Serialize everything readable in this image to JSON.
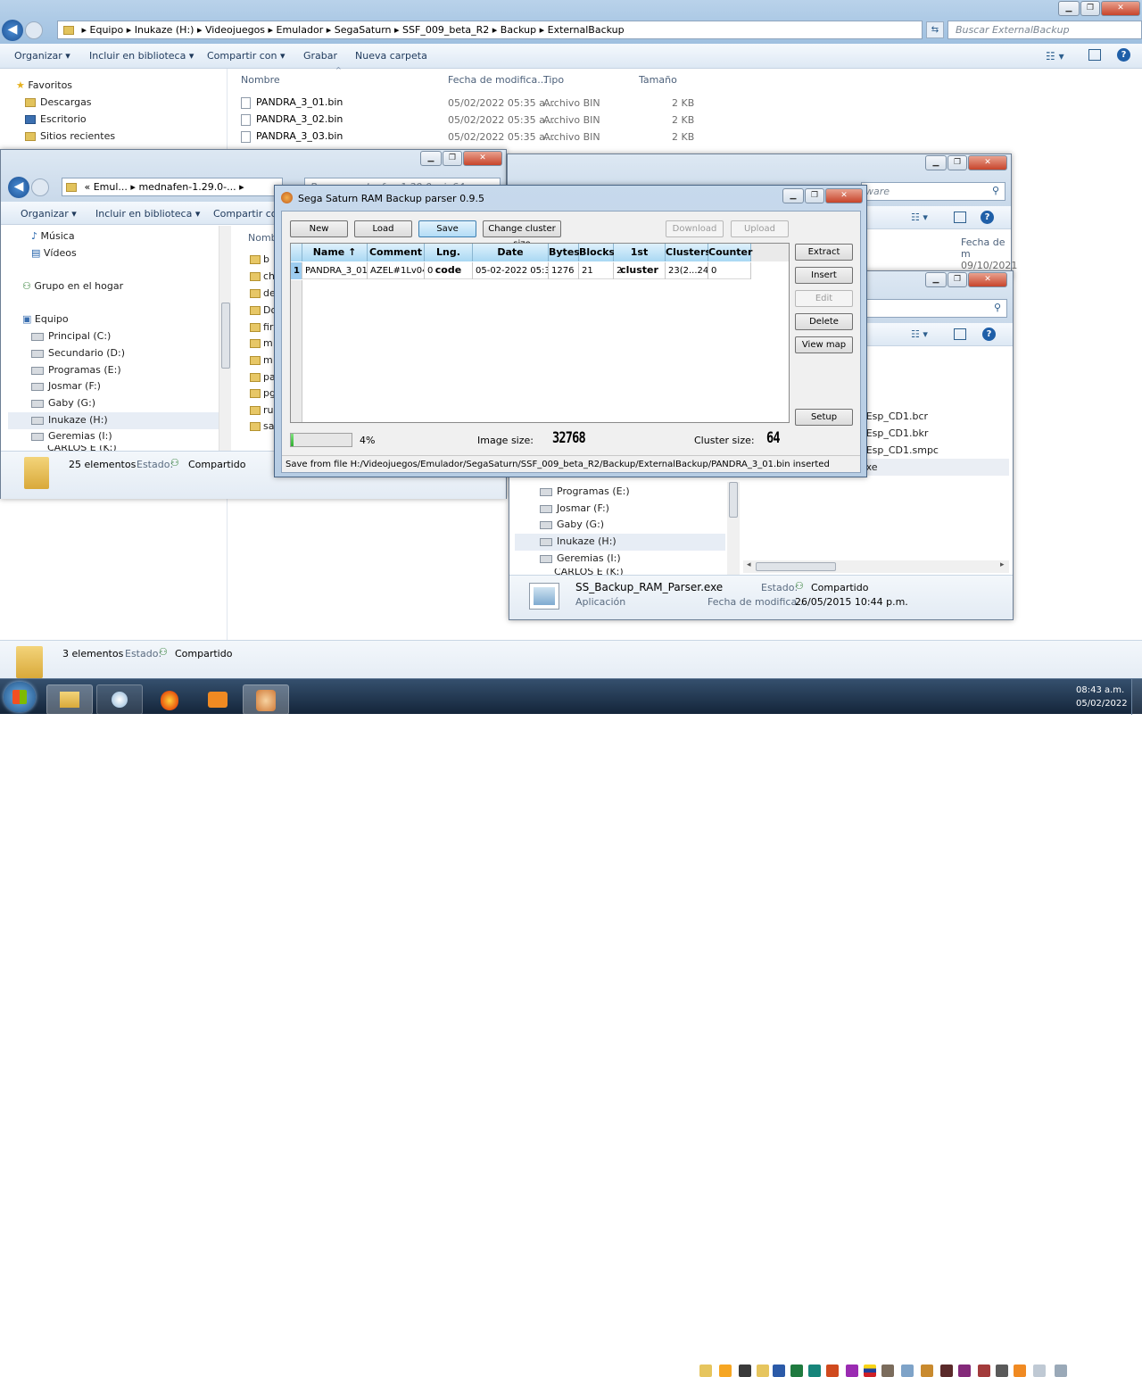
{
  "main_window": {
    "breadcrumb": [
      "Equipo",
      "Inukaze (H:)",
      "Videojuegos",
      "Emulador",
      "SegaSaturn",
      "SSF_009_beta_R2",
      "Backup",
      "ExternalBackup"
    ],
    "search_placeholder": "Buscar ExternalBackup",
    "toolbar": [
      "Organizar",
      "Incluir en biblioteca",
      "Compartir con",
      "Grabar",
      "Nueva carpeta"
    ],
    "nav": {
      "favorites": "Favoritos",
      "fav_items": [
        "Descargas",
        "Escritorio",
        "Sitios recientes"
      ]
    },
    "columns": [
      "Nombre",
      "Fecha de modifica...",
      "Tipo",
      "Tamaño"
    ],
    "files": [
      {
        "name": "PANDRA_3_01.bin",
        "date": "05/02/2022 05:35 a...",
        "type": "Archivo BIN",
        "size": "2 KB"
      },
      {
        "name": "PANDRA_3_02.bin",
        "date": "05/02/2022 05:35 a...",
        "type": "Archivo BIN",
        "size": "2 KB"
      },
      {
        "name": "PANDRA_3_03.bin",
        "date": "05/02/2022 05:35 a...",
        "type": "Archivo BIN",
        "size": "2 KB"
      }
    ],
    "status_count": "3 elementos",
    "status_label": "Estado:",
    "status_value": "Compartido"
  },
  "left_window": {
    "breadcrumb": [
      "«",
      "Emul...",
      "mednafen-1.29.0-..."
    ],
    "search_placeholder": "Buscar mednafen-1.29.0-win64",
    "toolbar": [
      "Organizar",
      "Incluir en biblioteca",
      "Compartir con"
    ],
    "nav": [
      "Música",
      "Vídeos",
      "Grupo en el hogar",
      "Equipo",
      "Principal (C:)",
      "Secundario (D:)",
      "Programas (E:)",
      "Josmar (F:)",
      "Gaby (G:)",
      "Inukaze (H:)",
      "Geremias (I:)",
      "CARLOS E (K:)"
    ],
    "column": "Nombr",
    "folders": [
      "b",
      "ch",
      "de",
      "Do",
      "fir",
      "m",
      "m",
      "pa",
      "pg",
      "ru",
      "sa"
    ],
    "status_count": "25 elementos",
    "status_label": "Estado:",
    "status_value": "Compartido"
  },
  "right_window_back": {
    "search_placeholder": "ware",
    "column": "Fecha de m",
    "date": "09/10/2021"
  },
  "right_window": {
    "files": [
      "ga-Esp_CD1.bcr",
      "ga-Esp_CD1.bkr",
      "ga-Esp_CD1.smpc",
      "r.exe"
    ],
    "nav": [
      "Programas (E:)",
      "Josmar (F:)",
      "Gaby (G:)",
      "Inukaze (H:)",
      "Geremias (I:)",
      "CARLOS E (K:)"
    ],
    "detail_name": "SS_Backup_RAM_Parser.exe",
    "detail_type": "Aplicación",
    "detail_state_label": "Estado:",
    "detail_state": "Compartido",
    "detail_date_label": "Fecha de modifica...",
    "detail_date": "26/05/2015 10:44 p.m."
  },
  "parser": {
    "title": "Sega Saturn RAM Backup parser 0.9.5",
    "buttons": {
      "new": "New",
      "load": "Load",
      "save": "Save",
      "cluster": "Change cluster size",
      "download": "Download",
      "upload": "Upload"
    },
    "side_buttons": {
      "extract": "Extract",
      "insert": "Insert",
      "edit": "Edit",
      "delete": "Delete",
      "view_map": "View map",
      "setup": "Setup"
    },
    "columns": [
      "Name ↑",
      "Comment",
      "Lng. code",
      "Date",
      "Bytes",
      "Blocks",
      "1st cluster",
      "Clusters",
      "Counter"
    ],
    "rows": [
      {
        "index": "1",
        "name": "PANDRA_3_01",
        "comment": "AZEL#1Lv04",
        "lng": "0",
        "date": "05-02-2022 05:34",
        "bytes": "1276",
        "blocks": "21",
        "first": "2",
        "clusters": "23(2...24)",
        "counter": "0"
      }
    ],
    "progress_percent": 4,
    "progress_label": "4%",
    "image_size_label": "Image size:",
    "image_size": "32768",
    "cluster_size_label": "Cluster size:",
    "cluster_size": "64",
    "status": "Save from file H:/Videojuegos/Emulador/SegaSaturn/SSF_009_beta_R2/Backup/ExternalBackup/PANDRA_3_01.bin inserted"
  },
  "taskbar": {
    "time": "08:43 a.m.",
    "date": "05/02/2022"
  },
  "colors": {
    "accent": "#3c7fb1",
    "taskbar": "#1c2f45",
    "header": "#a9d8f3"
  }
}
